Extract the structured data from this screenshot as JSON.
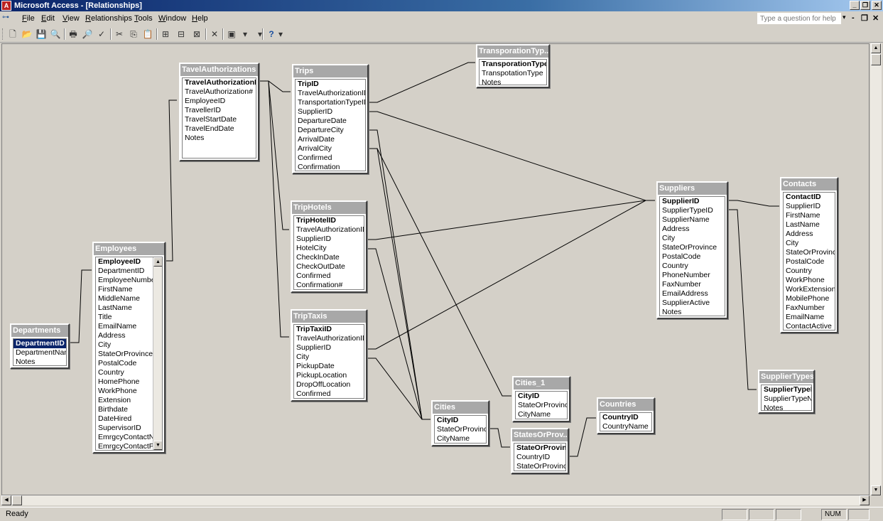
{
  "window": {
    "title": "Microsoft Access - [Relationships]",
    "icon": "access-icon",
    "app_icon_glyph": "A",
    "minimize": "_",
    "restore": "❐",
    "close": "✕"
  },
  "menubar": {
    "items": [
      "File",
      "Edit",
      "View",
      "Relationships",
      "Tools",
      "Window",
      "Help"
    ],
    "help_placeholder": "Type a question for help",
    "help_arrow": "▾",
    "mdi_minimize": "-",
    "mdi_restore": "❐",
    "mdi_close": "✕"
  },
  "toolbar": {
    "icons": [
      "new-icon",
      "open-icon",
      "save-icon",
      "file-search-icon",
      "print-icon",
      "print-preview-icon",
      "spelling-icon",
      "cut-icon",
      "copy-icon",
      "paste-icon",
      "show-table-icon",
      "show-direct-icon",
      "show-all-icon",
      "delete-icon",
      "new-object-icon",
      "new-object-dropdown-icon",
      "help-icon"
    ],
    "glyphs": [
      "🗋",
      "📂",
      "💾",
      "🔍",
      "🖶",
      "🔎",
      "✓",
      "✂",
      "⎘",
      "📋",
      "⊞",
      "⊟",
      "⊠",
      "✕",
      "▣",
      "▾",
      "?"
    ]
  },
  "tables": {
    "travel_authorizations": {
      "title": "TavelAuthorizations",
      "fields": [
        "TravelAuthorizationID",
        "TravelAuthorization#",
        "EmployeeID",
        "TravellerID",
        "TravelStartDate",
        "TravelEndDate",
        "Notes"
      ],
      "pk": "TravelAuthorizationID"
    },
    "trips": {
      "title": "Trips",
      "fields": [
        "TripID",
        "TravelAuthorizationID",
        "TransportationTypeID",
        "SupplierID",
        "DepartureDate",
        "DepartureCity",
        "ArrivalDate",
        "ArrivalCity",
        "Confirmed",
        "Confirmation"
      ],
      "pk": "TripID"
    },
    "transportation_types": {
      "title": "TransporationTyp...",
      "fields": [
        "TransporationTypeID",
        "TranspotationType",
        "Notes"
      ],
      "pk": "TransporationTypeID"
    },
    "trip_hotels": {
      "title": "TripHotels",
      "fields": [
        "TripHotelID",
        "TravelAuthorizationID",
        "SupplierID",
        "HotelCity",
        "CheckInDate",
        "CheckOutDate",
        "Confirmed",
        "Confirmation#"
      ],
      "pk": "TripHotelID"
    },
    "trip_taxis": {
      "title": "TripTaxis",
      "fields": [
        "TripTaxiID",
        "TravelAuthorizationID",
        "SupplierID",
        "City",
        "PickupDate",
        "PickupLocation",
        "DropOffLocation",
        "Confirmed"
      ],
      "pk": "TripTaxiID"
    },
    "employees": {
      "title": "Employees",
      "fields": [
        "EmployeeID",
        "DepartmentID",
        "EmployeeNumber",
        "FirstName",
        "MiddleName",
        "LastName",
        "Title",
        "EmailName",
        "Address",
        "City",
        "StateOrProvince",
        "PostalCode",
        "Country",
        "HomePhone",
        "WorkPhone",
        "Extension",
        "Birthdate",
        "DateHired",
        "SupervisorID",
        "EmrgcyContactNam",
        "EmrgcyContactPho"
      ],
      "pk": "EmployeeID"
    },
    "departments": {
      "title": "Departments",
      "fields": [
        "DepartmentID",
        "DepartmentName",
        "Notes"
      ],
      "pk": "DepartmentID"
    },
    "suppliers": {
      "title": "Suppliers",
      "fields": [
        "SupplierID",
        "SupplierTypeID",
        "SupplierName",
        "Address",
        "City",
        "StateOrProvince",
        "PostalCode",
        "Country",
        "PhoneNumber",
        "FaxNumber",
        "EmailAddress",
        "SupplierActive",
        "Notes"
      ],
      "pk": "SupplierID"
    },
    "contacts": {
      "title": "Contacts",
      "fields": [
        "ContactID",
        "SupplierID",
        "FirstName",
        "LastName",
        "Address",
        "City",
        "StateOrProvince",
        "PostalCode",
        "Country",
        "WorkPhone",
        "WorkExtension",
        "MobilePhone",
        "FaxNumber",
        "EmailName",
        "ContactActive"
      ],
      "pk": "ContactID"
    },
    "supplier_types": {
      "title": "SupplierTypes",
      "fields": [
        "SupplierTypeID",
        "SupplierTypeNam",
        "Notes"
      ],
      "pk": "SupplierTypeID"
    },
    "cities": {
      "title": "Cities",
      "fields": [
        "CityID",
        "StateOrProvinceI",
        "CityName"
      ],
      "pk": "CityID"
    },
    "cities_1": {
      "title": "Cities_1",
      "fields": [
        "CityID",
        "StateOrProvinceI",
        "CityName"
      ],
      "pk": "CityID"
    },
    "states": {
      "title": "StatesOrProv...",
      "fields": [
        "StateOrProvinceI",
        "CountryID",
        "StateOrProvince"
      ],
      "pk": "StateOrProvinceI"
    },
    "countries": {
      "title": "Countries",
      "fields": [
        "CountryID",
        "CountryName"
      ],
      "pk": "CountryID"
    }
  },
  "scroll": {
    "up": "▲",
    "down": "▼",
    "left": "◀",
    "right": "▶"
  },
  "statusbar": {
    "text": "Ready",
    "num": "NUM"
  }
}
